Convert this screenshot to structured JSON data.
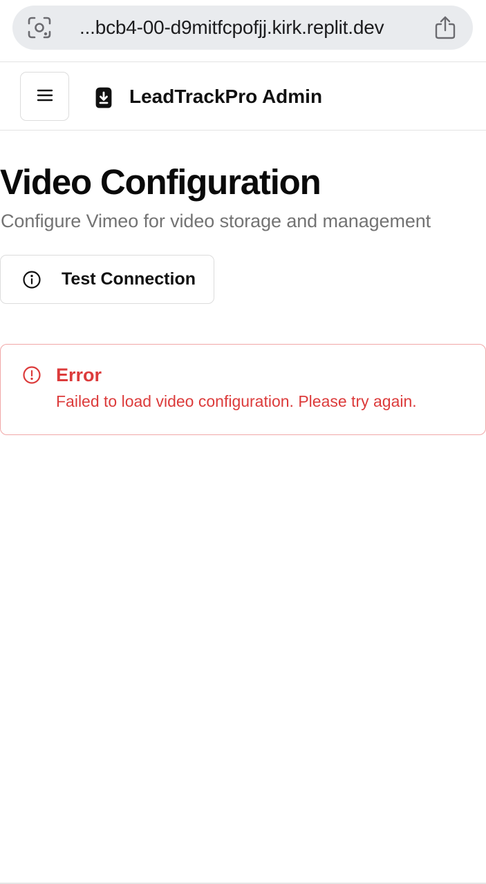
{
  "browser": {
    "url": "...bcb4-00-d9mitfcpofjj.kirk.replit.dev",
    "left_icon": "camera-scan-icon",
    "right_icon": "share-icon"
  },
  "header": {
    "menu_icon": "hamburger-menu-icon",
    "logo_icon": "bookmark-download-icon",
    "title": "LeadTrackPro Admin"
  },
  "main": {
    "title": "Video Configuration",
    "subtitle": "Configure Vimeo for video storage and management",
    "test_button": {
      "icon": "info-icon",
      "label": "Test Connection"
    },
    "error": {
      "icon": "alert-circle-icon",
      "title": "Error",
      "message": "Failed to load video configuration. Please try again.",
      "color": "#dc3b3b",
      "border_color": "#f0a7a7"
    }
  }
}
